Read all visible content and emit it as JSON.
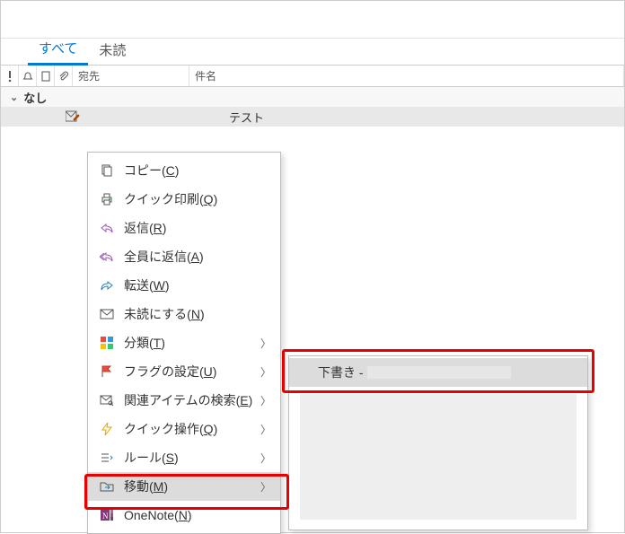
{
  "tabs": {
    "all": "すべて",
    "unread": "未読"
  },
  "headers": {
    "to": "宛先",
    "subject": "件名"
  },
  "group": {
    "label": "なし"
  },
  "message": {
    "subject": "テスト"
  },
  "menu": {
    "copy": {
      "pre": "コピー(",
      "mn": "C",
      "post": ")"
    },
    "quickprint": {
      "pre": "クイック印刷(",
      "mn": "Q",
      "post": ")"
    },
    "reply": {
      "pre": "返信(",
      "mn": "R",
      "post": ")"
    },
    "replyall": {
      "pre": "全員に返信(",
      "mn": "A",
      "post": ")"
    },
    "forward": {
      "pre": "転送(",
      "mn": "W",
      "post": ")"
    },
    "markunread": {
      "pre": "未読にする(",
      "mn": "N",
      "post": ")"
    },
    "categorize": {
      "pre": "分類(",
      "mn": "T",
      "post": ")"
    },
    "flag": {
      "pre": "フラグの設定(",
      "mn": "U",
      "post": ")"
    },
    "findrelated": {
      "pre": "関連アイテムの検索(",
      "mn": "E",
      "post": ")"
    },
    "quicksteps": {
      "pre": "クイック操作(",
      "mn": "Q",
      "post": ")"
    },
    "rules": {
      "pre": "ルール(",
      "mn": "S",
      "post": ")"
    },
    "move": {
      "pre": "移動(",
      "mn": "M",
      "post": ")"
    },
    "onenote": {
      "pre": "OneNote(",
      "mn": "N",
      "post": ")"
    }
  },
  "submenu": {
    "drafts": "下書き - "
  }
}
